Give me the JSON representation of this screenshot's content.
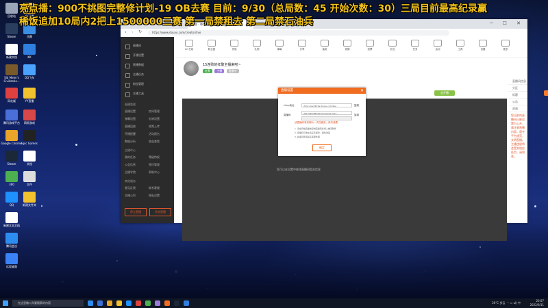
{
  "overlay": {
    "line1": "亮点播：900不挑图完整修计划-19 OB去赛  目前：9/30（总局数：45  开始次数：30）三局目前最高纪录赢",
    "line2": "稀饭追加10局内2把上1500000三赛  第一局禁租去  第二局禁石油兵"
  },
  "desktop_icons": [
    {
      "label": "回收站",
      "color": "#9aa6b8"
    },
    {
      "label": "YY开播",
      "color": "#f3c12e"
    },
    {
      "label": "Steam",
      "color": "#2a3f5f"
    },
    {
      "label": "迅雷",
      "color": "#3a8ee6"
    },
    {
      "label": "新建文档",
      "color": "#ffffff"
    },
    {
      "label": "KK",
      "color": "#2f7fe0"
    },
    {
      "label": "Sid Meier's Civilizatio...",
      "color": "#7a5a2a"
    },
    {
      "label": "QQ飞车",
      "color": "#4aa3ff"
    },
    {
      "label": "同花顺",
      "color": "#e04040"
    },
    {
      "label": "YY直播",
      "color": "#f2c12e"
    },
    {
      "label": "腾讯游戏平台",
      "color": "#4a6fd8"
    },
    {
      "label": "网易游戏",
      "color": "#d94848"
    },
    {
      "label": "Google Chrome",
      "color": "#e8a52a"
    },
    {
      "label": "Epic Games",
      "color": "#222222"
    },
    {
      "label": "Steam",
      "color": "#1b2838"
    },
    {
      "label": "文档",
      "color": "#ffffff"
    },
    {
      "label": "360",
      "color": "#4caf50"
    },
    {
      "label": "文件",
      "color": "#dddddd"
    },
    {
      "label": "QQ",
      "color": "#1e90ff"
    },
    {
      "label": "新建文件夹",
      "color": "#f3c12e"
    },
    {
      "label": "新建文本文档",
      "color": "#ffffff"
    },
    {
      "label": "腾讯会议",
      "color": "#2d8cf0"
    },
    {
      "label": "远程桌面",
      "color": "#3b82f6"
    }
  ],
  "browser": {
    "tab_title": "斗鱼 - 每个人的直播平台",
    "url": "https://www.douyu.com/creator/live"
  },
  "sidebar": {
    "items": [
      "直播间",
      "开播设置",
      "直播数据",
      "主播任务",
      "粉丝管理",
      "主播工具"
    ],
    "section1": "直播管理",
    "grid1": [
      "直播设置",
      "房间管理",
      "弹幕设置",
      "礼物设置",
      "直播回放",
      "视频上传",
      "开播提醒",
      "活动报名",
      "数据分析",
      "收益查看"
    ],
    "section2": "主播中心",
    "grid2": [
      "我的任务",
      "等级特权",
      "公会信息",
      "签约管理",
      "主播学院",
      "帮助中心"
    ],
    "section3": "其他服务",
    "grid3": [
      "意见反馈",
      "联系客服",
      "主播公约",
      "隐私设置"
    ],
    "btn_left": "停止直播",
    "btn_right": "开始直播"
  },
  "toolbar_items": [
    "12 在线",
    "粉丝团",
    "贵族",
    "礼物",
    "弹幕",
    "分享",
    "抽奖",
    "竞猜",
    "投票",
    "红包",
    "任务",
    "活动",
    "工具",
    "设置",
    "更多"
  ],
  "profile": {
    "title": "15连败的红警主播来啦~",
    "tags": [
      "红警",
      "主播",
      "直播中"
    ]
  },
  "dialog": {
    "title": "直播设置",
    "close": "✕",
    "label_rtmp": "rtmp地址",
    "value_rtmp": "rtmp://sendtc3a.douyu.com/live",
    "copy1": "复制",
    "label_key": "直播码",
    "value_key": "4417095rBFOhzcXm?wsSecret=...",
    "copy2": "复制",
    "warn": "该直播码有效期为一次性使用，请勿泄露",
    "note1": "1. 请在开始直播前复制直播码并填入推流软件",
    "note2": "2. 直播码与地址请妥善保管，避免泄露",
    "note3": "3. 如遇问题请联系客服处理",
    "ok": "确定"
  },
  "below_note": "您可以在设置中修改直播间相关信息",
  "right_panel": {
    "btn1": "去开播",
    "btn2": "设置",
    "rows": [
      "直播间信息",
      "分区",
      "标题",
      "公告",
      "封面"
    ],
    "orange": "您当前的直播间已被设置为公开，请注意直播内容，遵守平台规范，文明直播。主播违规将会受到相应处罚，请知悉。"
  },
  "taskbar": {
    "search": "在这里输入你要搜索的内容",
    "temp": "20°C 多云",
    "lang": "中",
    "time": "20:07",
    "date": "2022/9/11"
  }
}
